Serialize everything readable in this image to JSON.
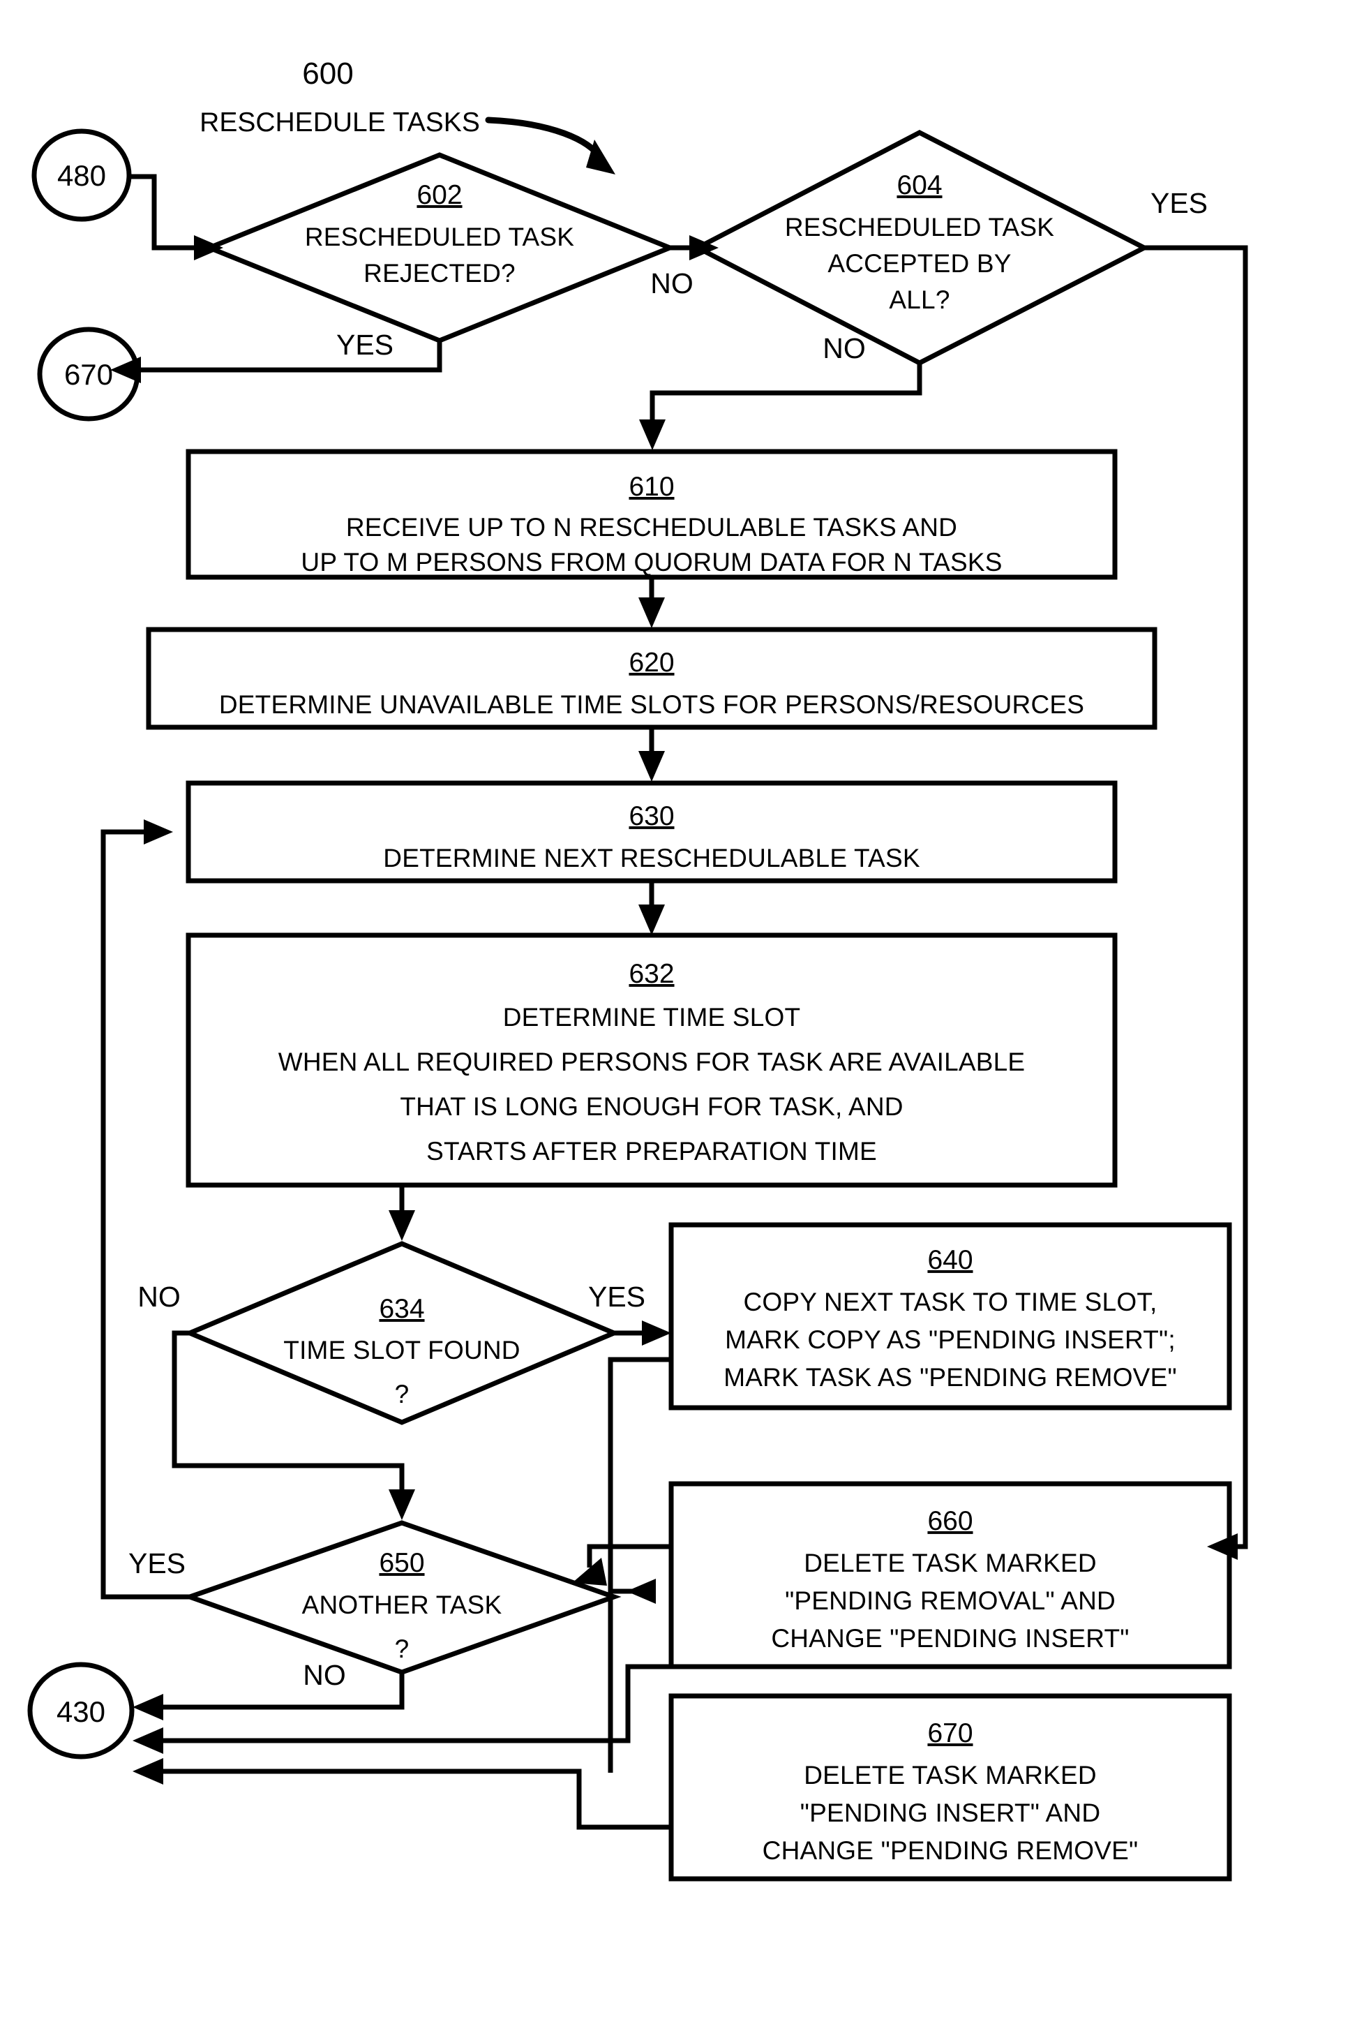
{
  "figure": {
    "number": "600",
    "title": "RESCHEDULE TASKS"
  },
  "connectors": {
    "entry": "480",
    "exit_reject": "670",
    "exit_done": "430"
  },
  "nodes": {
    "d602": {
      "ref": "602",
      "lines": [
        "RESCHEDULED TASK",
        "REJECTED?"
      ]
    },
    "d604": {
      "ref": "604",
      "lines": [
        "RESCHEDULED TASK",
        "ACCEPTED BY",
        "ALL?"
      ]
    },
    "b610": {
      "ref": "610",
      "lines": [
        "RECEIVE UP TO N RESCHEDULABLE TASKS AND",
        "UP TO M PERSONS FROM QUORUM DATA FOR N TASKS"
      ]
    },
    "b620": {
      "ref": "620",
      "lines": [
        "DETERMINE UNAVAILABLE TIME SLOTS FOR PERSONS/RESOURCES"
      ]
    },
    "b630": {
      "ref": "630",
      "lines": [
        "DETERMINE NEXT RESCHEDULABLE TASK"
      ]
    },
    "b632": {
      "ref": "632",
      "lines": [
        "DETERMINE TIME SLOT",
        "WHEN ALL REQUIRED PERSONS FOR TASK ARE AVAILABLE",
        "THAT IS LONG ENOUGH FOR TASK, AND",
        "STARTS AFTER PREPARATION TIME"
      ]
    },
    "d634": {
      "ref": "634",
      "lines": [
        "TIME SLOT FOUND",
        "?"
      ]
    },
    "b640": {
      "ref": "640",
      "lines": [
        "COPY NEXT TASK TO TIME SLOT,",
        "MARK COPY AS  \"PENDING INSERT\";",
        "MARK TASK AS \"PENDING REMOVE\""
      ]
    },
    "d650": {
      "ref": "650",
      "lines": [
        "ANOTHER TASK",
        "?"
      ]
    },
    "b660": {
      "ref": "660",
      "lines": [
        "DELETE TASK MARKED",
        "\"PENDING REMOVAL\" AND",
        "CHANGE \"PENDING INSERT\""
      ]
    },
    "b670": {
      "ref": "670",
      "lines": [
        "DELETE TASK MARKED",
        "\"PENDING INSERT\" AND",
        "CHANGE \"PENDING REMOVE\""
      ]
    }
  },
  "edge_labels": {
    "e602_yes": "YES",
    "e602_no": "NO",
    "e604_yes": "YES",
    "e604_no": "NO",
    "e634_yes": "YES",
    "e634_no": "NO",
    "e650_yes": "YES",
    "e650_no": "NO"
  },
  "colors": {
    "ink": "#000000",
    "paper": "#ffffff"
  }
}
